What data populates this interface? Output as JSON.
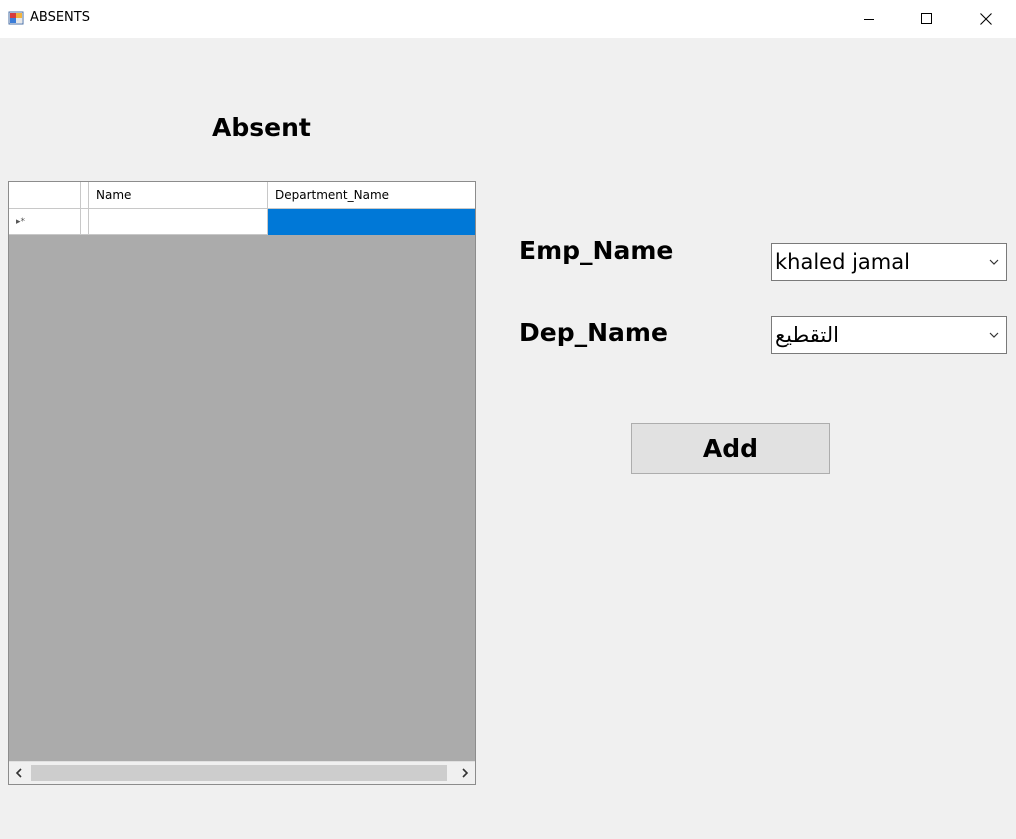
{
  "window": {
    "title": "ABSENTS",
    "icon": "windows-form-icon"
  },
  "form": {
    "heading": "Absent"
  },
  "grid": {
    "columns": [
      "Name",
      "Department_Name"
    ],
    "new_row": {
      "indicator": "▸*",
      "name": "",
      "department_name": ""
    },
    "selected_cell_color": "#0078d7",
    "background_color": "#ababab"
  },
  "fields": {
    "emp_label": "Emp_Name",
    "emp_value": "khaled jamal",
    "dep_label": "Dep_Name",
    "dep_value": "التقطيع"
  },
  "actions": {
    "add_label": "Add"
  }
}
